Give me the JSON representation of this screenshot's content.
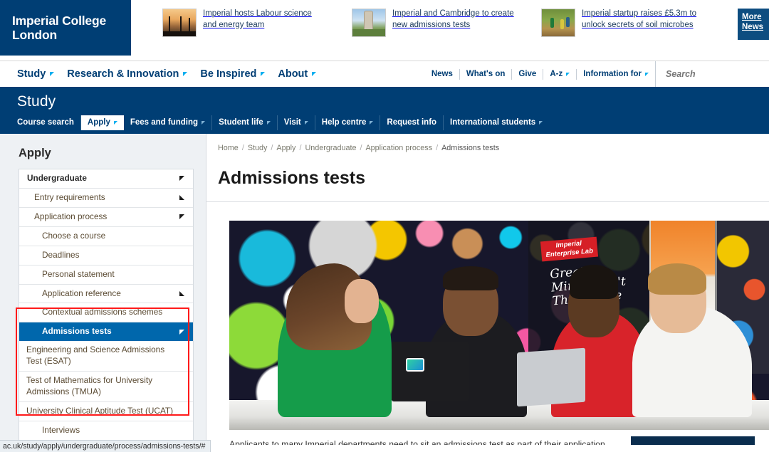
{
  "brand": {
    "logo_line1": "Imperial College",
    "logo_line2": "London",
    "primary_dark": "#003e74",
    "primary_bright": "#0067ac",
    "accent_cyan": "#00aeef",
    "highlight_red": "#ff1a1a"
  },
  "news_bar": {
    "items": [
      {
        "title": "Imperial hosts Labour science and energy team",
        "thumb": "pylon-photo"
      },
      {
        "title": "Imperial and Cambridge to create new admissions tests",
        "thumb": "tower-photo"
      },
      {
        "title": "Imperial startup raises £5.3m to unlock secrets of soil microbes",
        "thumb": "field-photo"
      }
    ],
    "more_label_line1": "More",
    "more_label_line2": "News"
  },
  "main_nav": {
    "primary": [
      {
        "label": "Study",
        "has_dropdown": true
      },
      {
        "label": "Research & Innovation",
        "has_dropdown": true
      },
      {
        "label": "Be Inspired",
        "has_dropdown": true
      },
      {
        "label": "About",
        "has_dropdown": true
      }
    ],
    "utility": [
      {
        "label": "News",
        "has_dropdown": false
      },
      {
        "label": "What's on",
        "has_dropdown": false
      },
      {
        "label": "Give",
        "has_dropdown": false
      },
      {
        "label": "A-z",
        "has_dropdown": true
      },
      {
        "label": "Information for",
        "has_dropdown": true
      }
    ],
    "search": {
      "placeholder": "Search",
      "value": ""
    }
  },
  "section": {
    "title": "Study",
    "nav": [
      {
        "label": "Course search",
        "has_dropdown": false,
        "active": false
      },
      {
        "label": "Apply",
        "has_dropdown": true,
        "active": true
      },
      {
        "label": "Fees and funding",
        "has_dropdown": true,
        "active": false
      },
      {
        "label": "Student life",
        "has_dropdown": true,
        "active": false
      },
      {
        "label": "Visit",
        "has_dropdown": true,
        "active": false
      },
      {
        "label": "Help centre",
        "has_dropdown": true,
        "active": false
      },
      {
        "label": "Request info",
        "has_dropdown": false,
        "active": false
      },
      {
        "label": "International students",
        "has_dropdown": true,
        "active": false
      }
    ]
  },
  "sidebar": {
    "heading": "Apply",
    "items": [
      {
        "label": "Undergraduate",
        "level": 0,
        "marker": "down",
        "active": false
      },
      {
        "label": "Entry requirements",
        "level": 1,
        "marker": "up",
        "active": false
      },
      {
        "label": "Application process",
        "level": 1,
        "marker": "down",
        "active": false
      },
      {
        "label": "Choose a course",
        "level": 2,
        "marker": "none",
        "active": false
      },
      {
        "label": "Deadlines",
        "level": 2,
        "marker": "none",
        "active": false
      },
      {
        "label": "Personal statement",
        "level": 2,
        "marker": "none",
        "active": false
      },
      {
        "label": "Application reference",
        "level": 2,
        "marker": "up",
        "active": false
      },
      {
        "label": "Contextual admissions schemes",
        "level": 2,
        "marker": "none",
        "active": false
      },
      {
        "label": "Admissions tests",
        "level": 2,
        "marker": "down",
        "active": true
      },
      {
        "label": "Engineering and Science Admissions Test (ESAT)",
        "level": 3,
        "marker": "none",
        "active": false
      },
      {
        "label": "Test of Mathematics for University Admissions (TMUA)",
        "level": 3,
        "marker": "none",
        "active": false
      },
      {
        "label": "University Clinical Aptitude Test (UCAT)",
        "level": 3,
        "marker": "none",
        "active": false
      },
      {
        "label": "Interviews",
        "level": 2,
        "marker": "none",
        "active": false
      }
    ]
  },
  "content": {
    "breadcrumb": [
      "Home",
      "Study",
      "Apply",
      "Undergraduate",
      "Application process",
      "Admissions tests"
    ],
    "title": "Admissions tests",
    "hero": {
      "alt": "Four students collaborating at a desk in front of a colourful graffiti mural",
      "mural_badge": "Imperial\nEnterprise Lab",
      "mural_slogan_line1": "Great",
      "mural_slogan_line2": "Minds Don't",
      "mural_slogan_line3": "Think Alike"
    },
    "intro_text": "Applicants to many Imperial departments need to sit an admissions test as part of their application"
  },
  "status_bar": {
    "url": "ac.uk/study/apply/undergraduate/process/admissions-tests/#"
  }
}
